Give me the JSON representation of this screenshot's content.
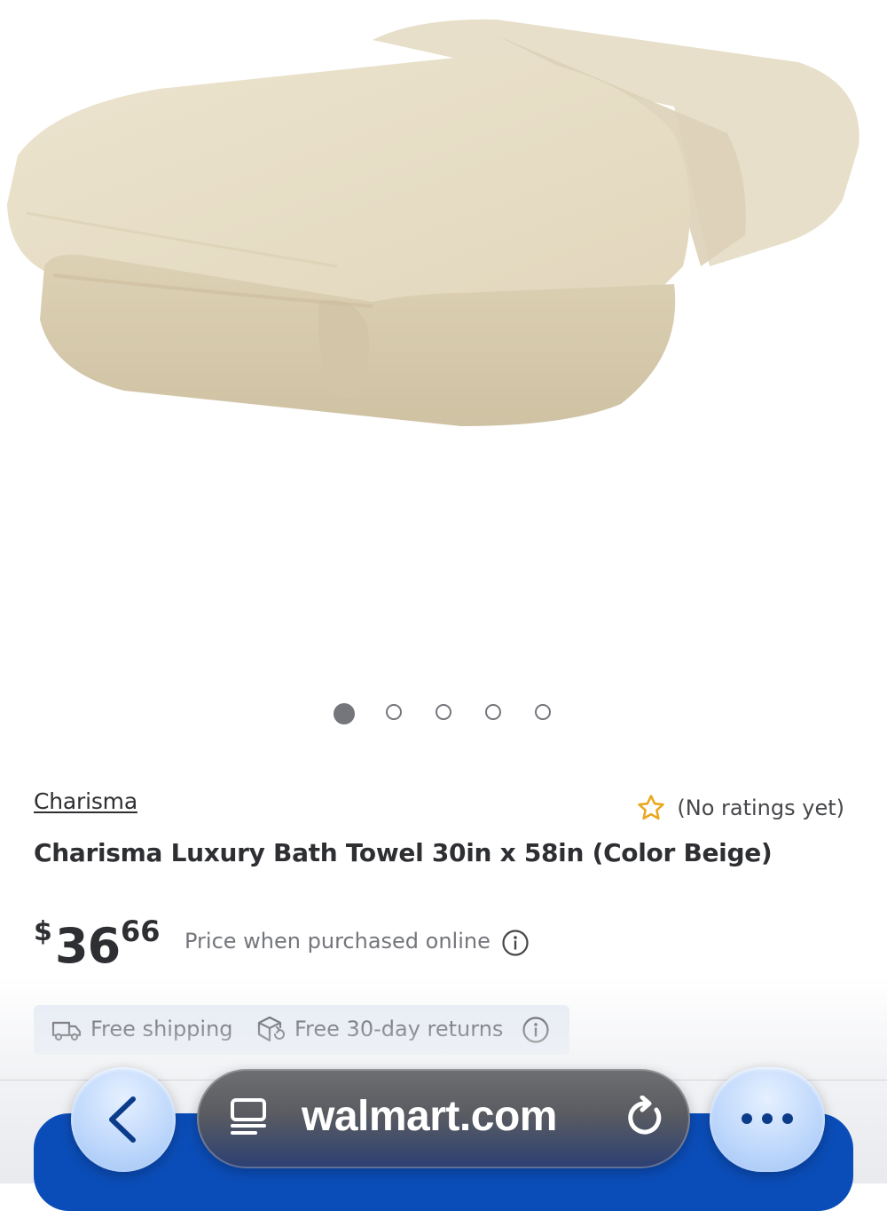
{
  "product": {
    "brand": "Charisma",
    "title": "Charisma Luxury Bath Towel 30in x 58in (Color Beige)",
    "rating_text": "(No ratings yet)",
    "price": {
      "currency": "$",
      "dollars": "36",
      "cents": "66",
      "note": "Price when purchased online"
    },
    "image_color": "#e6dcc3"
  },
  "carousel": {
    "count": 5,
    "active_index": 0
  },
  "shipping": {
    "free_shipping_label": "Free shipping",
    "returns_label": "Free 30-day returns"
  },
  "browser": {
    "url": "walmart.com"
  },
  "colors": {
    "walmart_blue": "#0b4db8",
    "star_gold": "#e8a820",
    "banner_bg": "#e6ecf6",
    "text_primary": "#2e2f32",
    "text_secondary": "#74767c"
  },
  "icons": {
    "rating": "star-outline-icon",
    "price_info": "info-circle-icon",
    "shipping": "delivery-truck-icon",
    "returns": "returns-box-icon",
    "shipping_info": "info-circle-icon",
    "back": "chevron-left-icon",
    "reader": "reader-mode-icon",
    "reload": "reload-icon",
    "more": "more-dots-icon"
  }
}
